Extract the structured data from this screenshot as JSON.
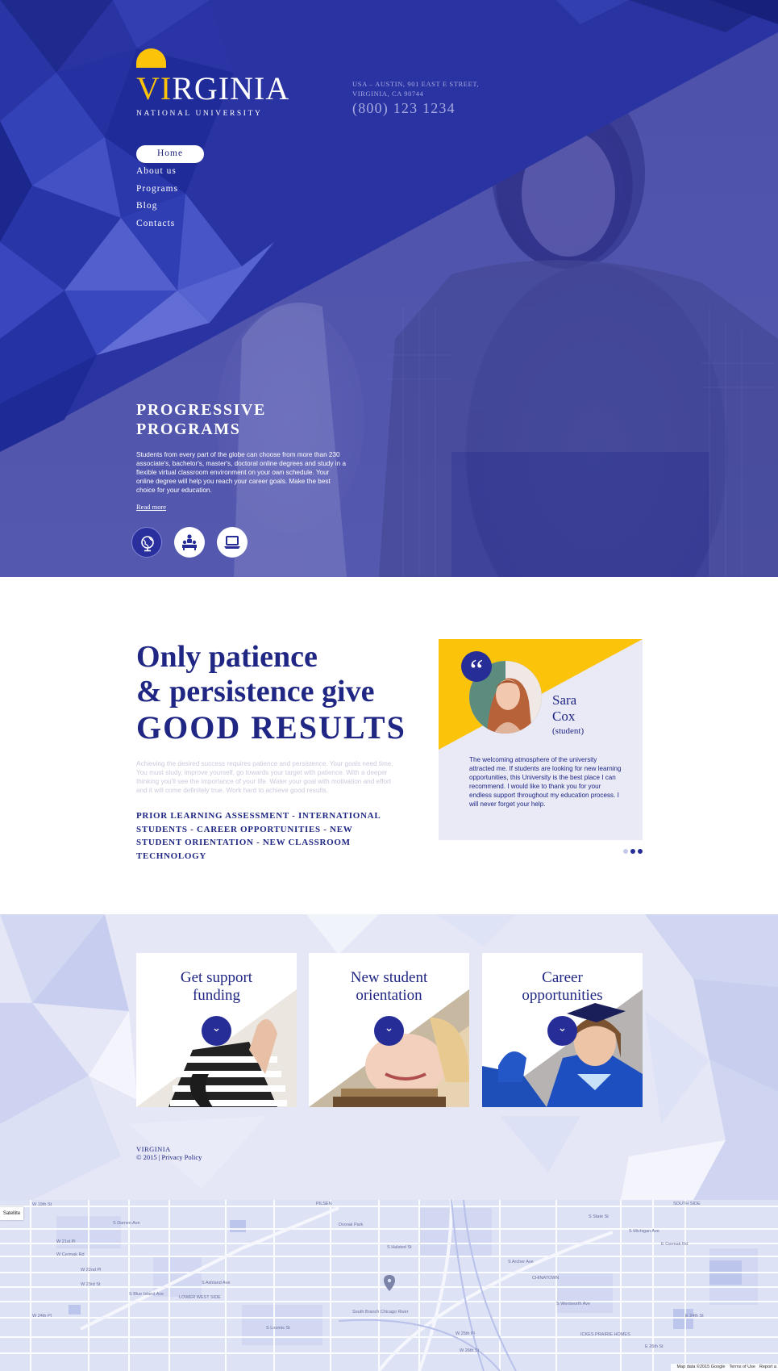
{
  "header": {
    "logo": {
      "word_accent": "VI",
      "word_rest": "RGINIA",
      "subtitle": "NATIONAL UNIVERSITY"
    },
    "address": "USA – AUSTIN, 901 EAST E STREET, VIRGINIA, CA 90744",
    "phone": "(800) 123 1234"
  },
  "nav": {
    "items": [
      {
        "label": "Home",
        "active": true
      },
      {
        "label": "About us"
      },
      {
        "label": "Programs"
      },
      {
        "label": "Blog"
      },
      {
        "label": "Contacts"
      }
    ]
  },
  "hero": {
    "title_line1": "PROGRESSIVE",
    "title_line2": "PROGRAMS",
    "text": "Students from every part of the globe can choose from more than 230 associate's, bachelor's, master's, doctoral online degrees and study in a flexible virtual classroom environment on your own schedule. Your online degree will help you reach your career goals. Make the best choice for your education.",
    "read_more": "Read more",
    "icons": [
      "globe-icon",
      "classroom-icon",
      "laptop-icon"
    ]
  },
  "about": {
    "heading_line1": "Only patience",
    "heading_line2": "& persistence give",
    "heading_line3": "GOOD RESULTS",
    "text": "Achieving the desired success requires patience and persistence. Your goals need time. You must study, improve yourself, go towards your target with patience. With a deeper thinking you'll see the importance of your life. Water your goal with motivation and effort and it will come definitely true. Work hard to achieve good results.",
    "links": "PRIOR LEARNING ASSESSMENT - INTERNATIONAL STUDENTS - CAREER OPPORTUNITIES - NEW STUDENT ORIENTATION - NEW CLASSROOM TECHNOLOGY"
  },
  "testimonial": {
    "quote_mark": "“",
    "name_first": "Sara",
    "name_last": "Cox",
    "role": "(student)",
    "text": "The welcoming atmosphere of the university attracted me. If students are looking for new learning opportunities, this University is the best place I can recommend. I would like to thank you for your endless support throughout my education process. I will never forget your help.",
    "slide_count": 3,
    "active_slide": 1
  },
  "services": {
    "cards": [
      {
        "title_line1": "Get support",
        "title_line2": "funding",
        "button": "⌄"
      },
      {
        "title_line1": "New student",
        "title_line2": "orientation",
        "button": "⌄"
      },
      {
        "title_line1": "Career",
        "title_line2": "opportunities",
        "button": "⌄"
      }
    ]
  },
  "footer": {
    "brand": "VIRGINIA",
    "copyright": "© 2015 | Privacy Policy"
  },
  "map": {
    "type_button": "Satellite",
    "attribution": "Map data ©2015 Google",
    "terms": "Terms of Use",
    "report": "Report a",
    "streets": [
      "W 19th St",
      "W 21st Pl",
      "W Cermak Rd",
      "W 22nd Pl",
      "W 23rd St",
      "W 24th Pl",
      "S Blue Island Ave",
      "PILSEN",
      "Dvorak Park",
      "LOWER WEST SIDE",
      "CHINATOWN",
      "S Archer Ave",
      "E Cermak Rd",
      "E 24th St",
      "E 26th St",
      "ICKES PRAIRIE HOMES",
      "S Michigan Ave",
      "SOUTH SIDE",
      "South Branch Chicago River",
      "S Damen Ave",
      "S Ashland Ave",
      "S Loomis St",
      "S Halsted St",
      "S State St",
      "S Wentworth Ave",
      "W 25th Pl",
      "W 26th St"
    ]
  },
  "colors": {
    "primary": "#262d97",
    "hero_blue": "#2a34a3",
    "accent_yellow": "#fcc30b",
    "light_bg": "#e5e7f6",
    "text_dark": "#1f2683"
  }
}
